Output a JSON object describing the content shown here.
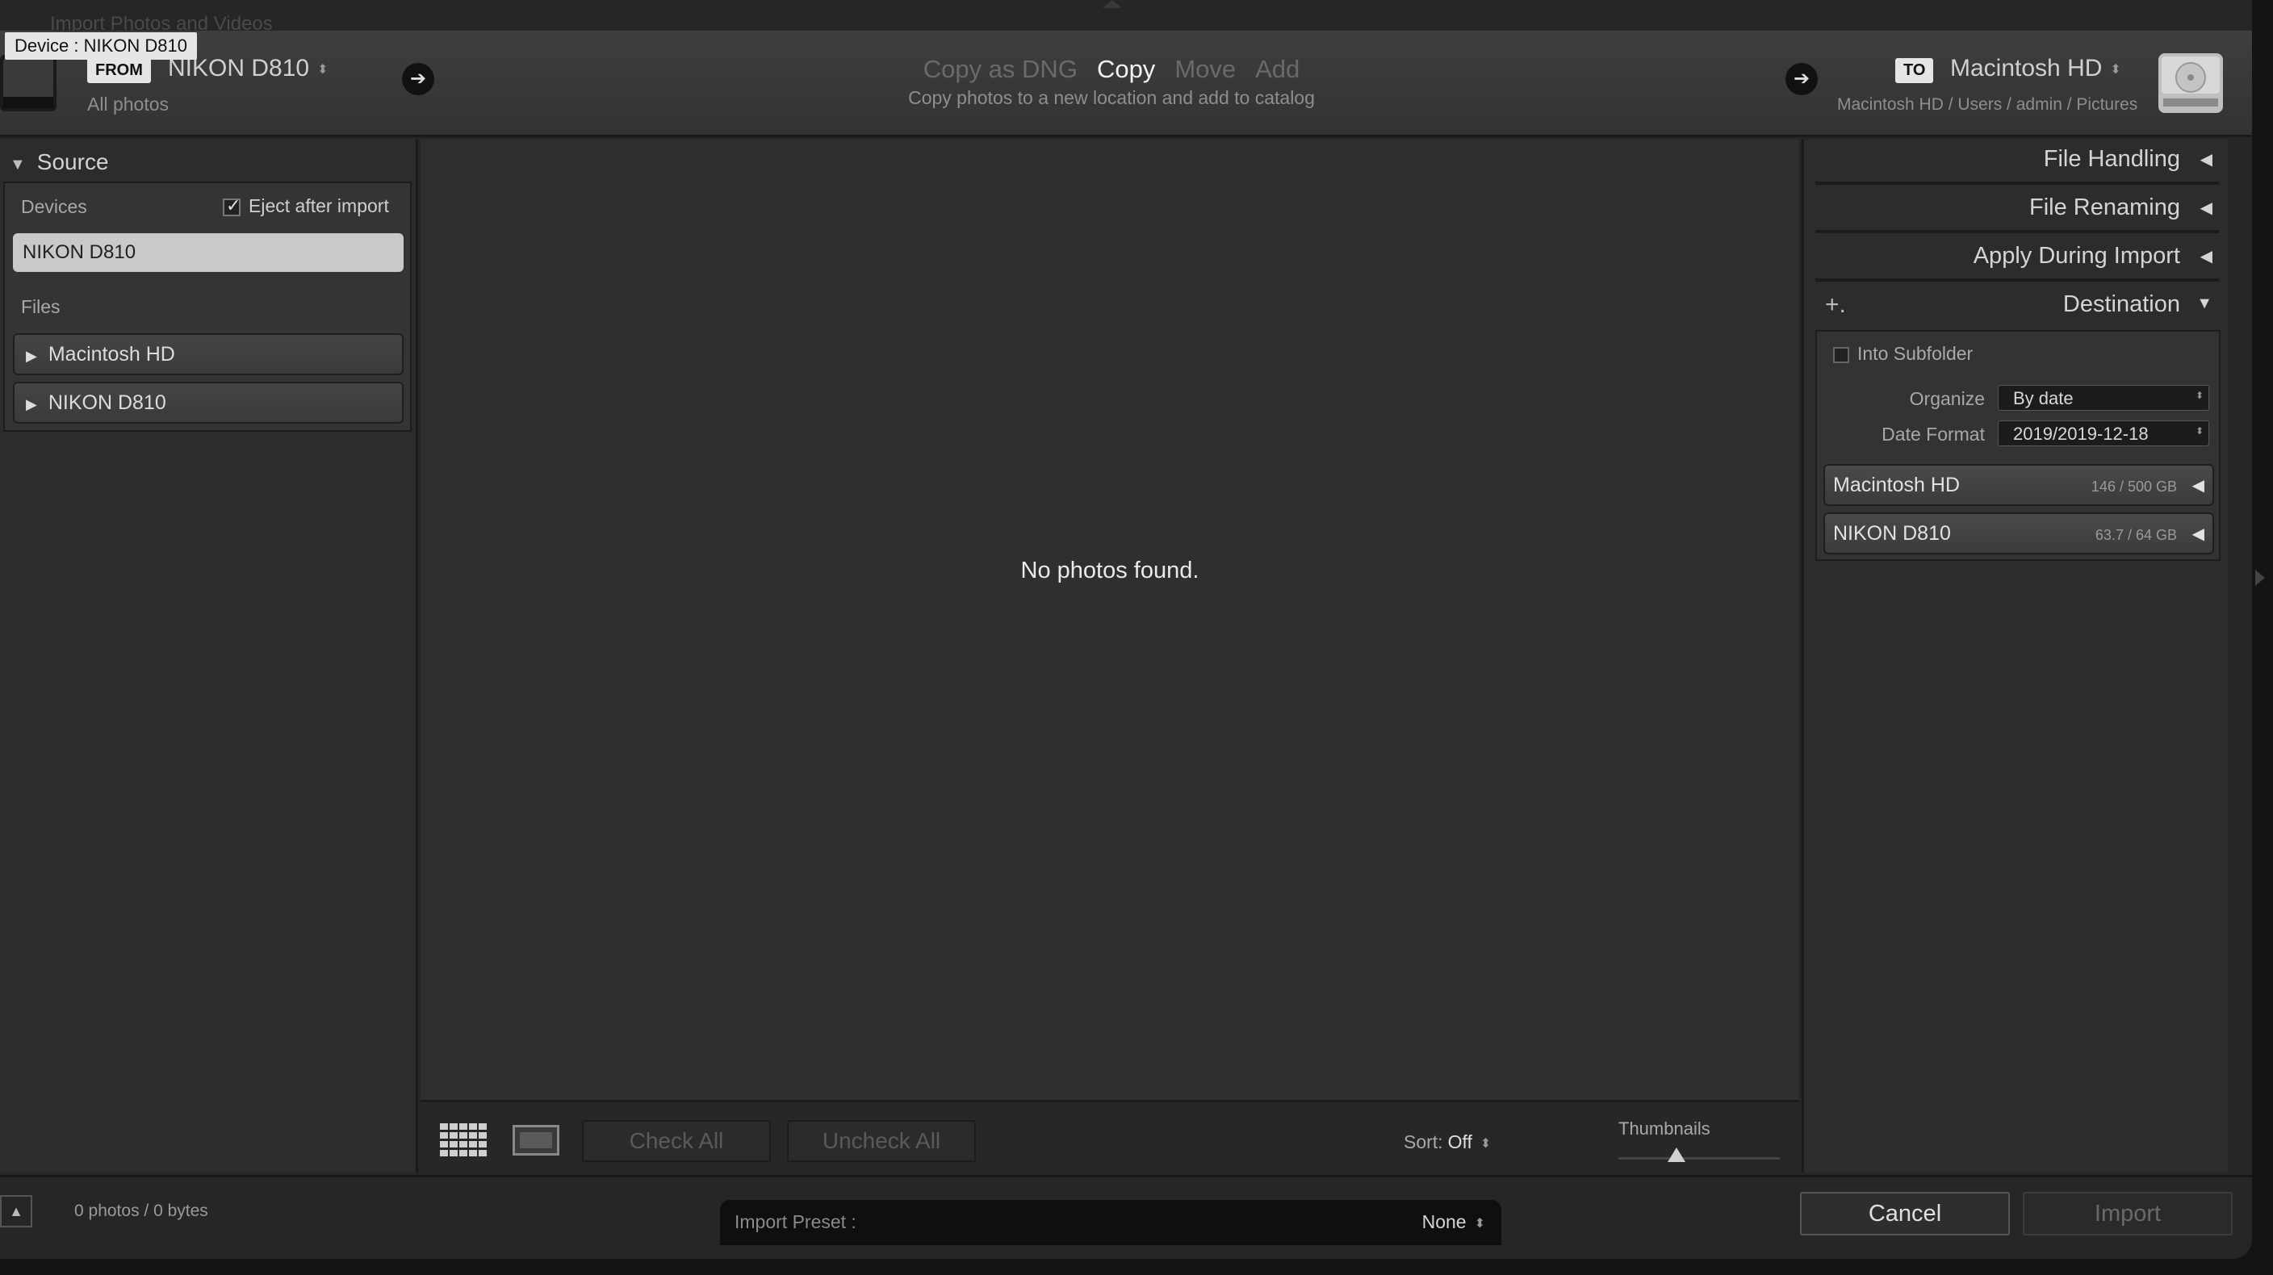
{
  "window": {
    "background_title": "Import Photos and Videos"
  },
  "tooltip": {
    "text": "Device : NIKON D810"
  },
  "header": {
    "from_label": "FROM",
    "source_name": "NIKON D810",
    "source_sub": "All photos",
    "modes": [
      "Copy as DNG",
      "Copy",
      "Move",
      "Add"
    ],
    "active_mode": "Copy",
    "mode_description": "Copy photos to a new location and add to catalog",
    "to_label": "TO",
    "dest_name": "Macintosh HD",
    "dest_path": "Macintosh HD / Users / admin / Pictures",
    "updown_glyph": "⬍",
    "arrow_glyph": "➔"
  },
  "source_panel": {
    "title": "Source",
    "devices_label": "Devices",
    "eject_label": "Eject after import",
    "eject_checked": true,
    "selected_device": "NIKON D810",
    "files_label": "Files",
    "files": [
      "Macintosh HD",
      "NIKON D810"
    ]
  },
  "grid": {
    "empty_message": "No photos found."
  },
  "toolbar": {
    "check_all": "Check All",
    "uncheck_all": "Uncheck All",
    "sort_label": "Sort:",
    "sort_value": "Off",
    "thumbnails_label": "Thumbnails"
  },
  "right_panel": {
    "sections": [
      "File Handling",
      "File Renaming",
      "Apply During Import"
    ],
    "destination_title": "Destination",
    "plus_label": "+.",
    "into_subfolder": "Into Subfolder",
    "organize_label": "Organize",
    "organize_value": "By date",
    "date_format_label": "Date Format",
    "date_format_value": "2019/2019-12-18",
    "volumes": [
      {
        "name": "Macintosh HD",
        "size": "146 / 500 GB"
      },
      {
        "name": "NIKON D810",
        "size": "63.7 / 64 GB"
      }
    ]
  },
  "bottom": {
    "count": "0 photos / 0 bytes",
    "preset_label": "Import Preset :",
    "preset_value": "None",
    "cancel": "Cancel",
    "import": "Import"
  }
}
